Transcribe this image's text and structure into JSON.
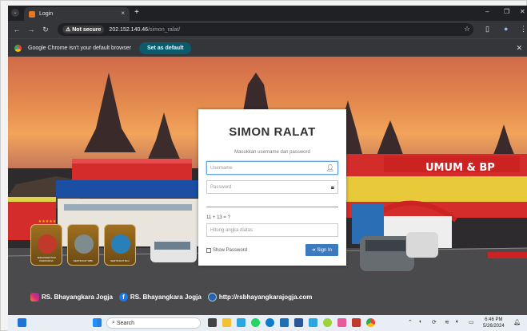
{
  "browser": {
    "tab_title": "Login",
    "tab_close": "×",
    "new_tab": "+",
    "security_label": "Not secure",
    "url_host": "202.152.140.46",
    "url_path": "/simon_ralat/",
    "infobar_text": "Google Chrome isn't your default browser",
    "set_default_label": "Set as default"
  },
  "login": {
    "title": "SIMON RALAT",
    "subtitle": "Masukkan username dan password",
    "username_placeholder": "Username",
    "password_placeholder": "Password",
    "captcha_question": "11 + 13 = ?",
    "captcha_placeholder": "Hitung angka diatas",
    "show_password_label": "Show Password",
    "signin_label": "Sign In"
  },
  "badges": [
    {
      "caption": "TERAKREDITASI PARIPURNA",
      "color": "#c0392b"
    },
    {
      "caption": "SERTIFIKAT WBK",
      "color": "#7f8c8d"
    },
    {
      "caption": "SERTIFIKAT BLU",
      "color": "#2980b9"
    }
  ],
  "badge_stars": "★★★★★",
  "footer": {
    "instagram": "RS. Bhayangkara Jogja",
    "facebook": "RS. Bhayangkara Jogja",
    "website": "http://rsbhayangkarajogja.com"
  },
  "background_sign": "UMUM & BP",
  "taskbar": {
    "search_label": "Search",
    "time": "6:46 PM",
    "date": "5/26/2024"
  }
}
